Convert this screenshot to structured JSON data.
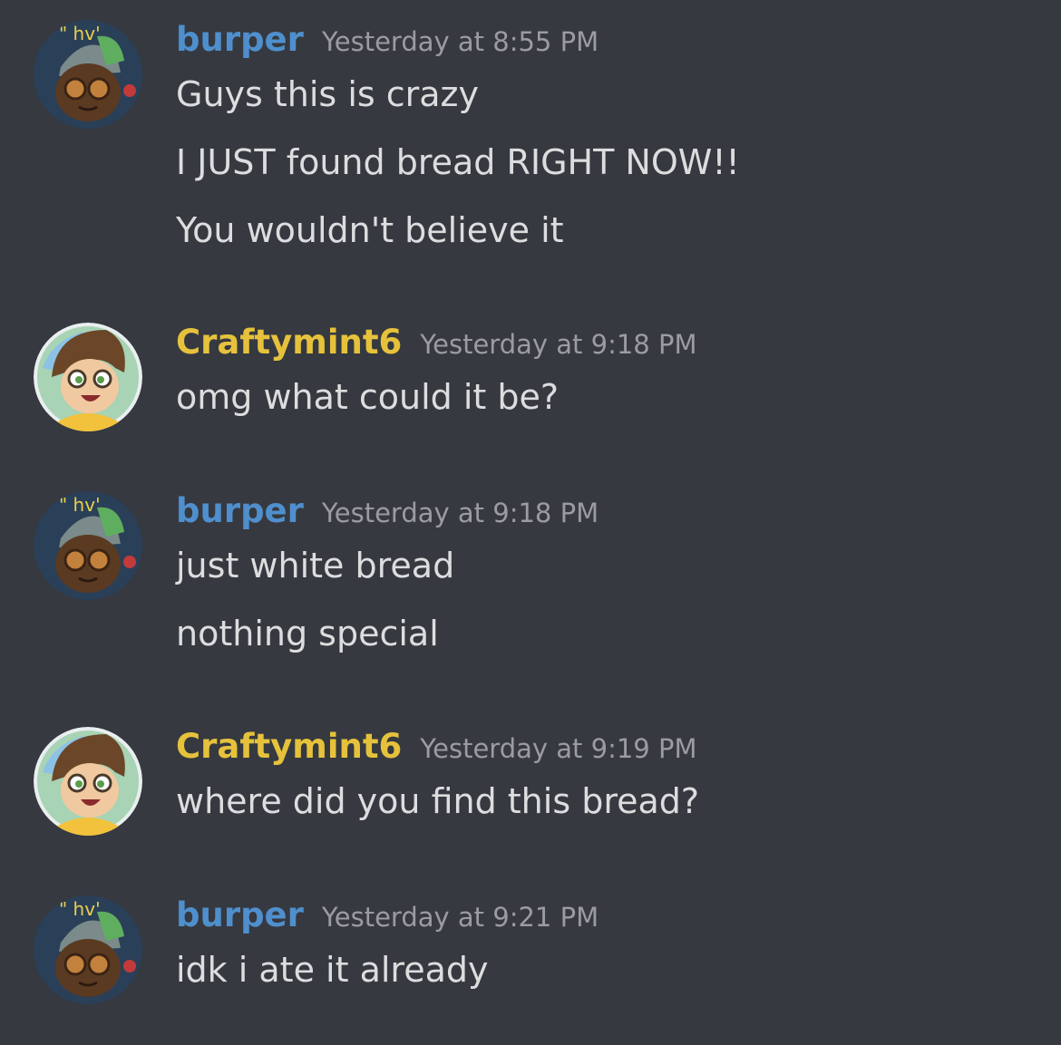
{
  "colors": {
    "background": "#36393f",
    "burper_name": "#4f8fcd",
    "craftymint_name": "#e6c23c",
    "timestamp": "#9a9ca1",
    "message_text": "#dcddde"
  },
  "messages": [
    {
      "username": "burper",
      "timestamp": "Yesterday at 8:55 PM",
      "avatar": "burper-avatar",
      "lines": [
        "Guys this is crazy",
        "I JUST found bread RIGHT NOW!!",
        "You wouldn't believe it"
      ]
    },
    {
      "username": "Craftymint6",
      "timestamp": "Yesterday at 9:18 PM",
      "avatar": "craftymint-avatar",
      "lines": [
        "omg what could it be?"
      ]
    },
    {
      "username": "burper",
      "timestamp": "Yesterday at 9:18 PM",
      "avatar": "burper-avatar",
      "lines": [
        "just white bread",
        "nothing special"
      ]
    },
    {
      "username": "Craftymint6",
      "timestamp": "Yesterday at 9:19 PM",
      "avatar": "craftymint-avatar",
      "lines": [
        "where did you find this bread?"
      ]
    },
    {
      "username": "burper",
      "timestamp": "Yesterday at 9:21 PM",
      "avatar": "burper-avatar",
      "lines": [
        "idk i ate it already"
      ]
    }
  ]
}
